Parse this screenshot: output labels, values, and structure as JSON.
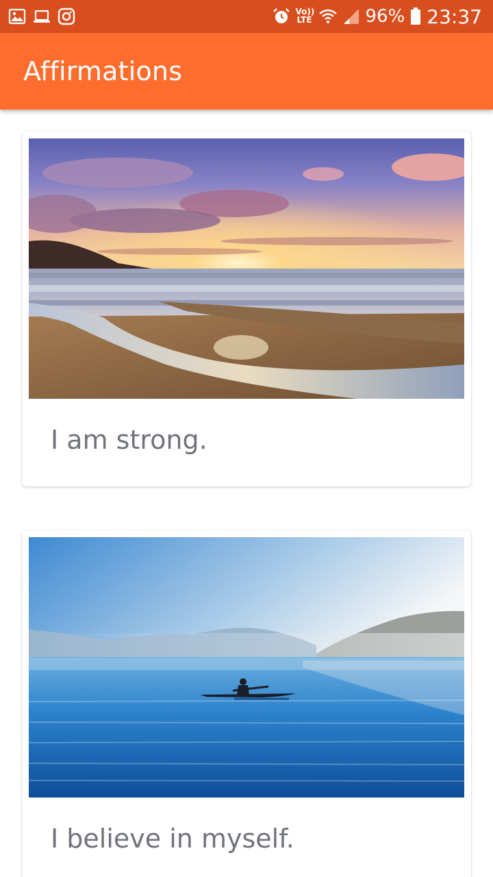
{
  "status_bar": {
    "left_icons": [
      "gallery-icon",
      "laptop-icon",
      "instagram-icon"
    ],
    "right_icons": [
      "alarm-icon",
      "volte-icon",
      "wifi-icon",
      "signal-icon",
      "battery-icon"
    ],
    "volte_top": "Vo))",
    "volte_bottom": "LTE",
    "battery_percent": "96%",
    "time": "23:37"
  },
  "app_bar": {
    "title": "Affirmations"
  },
  "cards": [
    {
      "image": "beach-sunset-image",
      "text": "I am strong."
    },
    {
      "image": "lake-kayak-image",
      "text": "I believe in myself."
    }
  ],
  "colors": {
    "status_bar": "#d94e1f",
    "app_bar": "#ff6d2e",
    "card_text": "#70737a"
  }
}
